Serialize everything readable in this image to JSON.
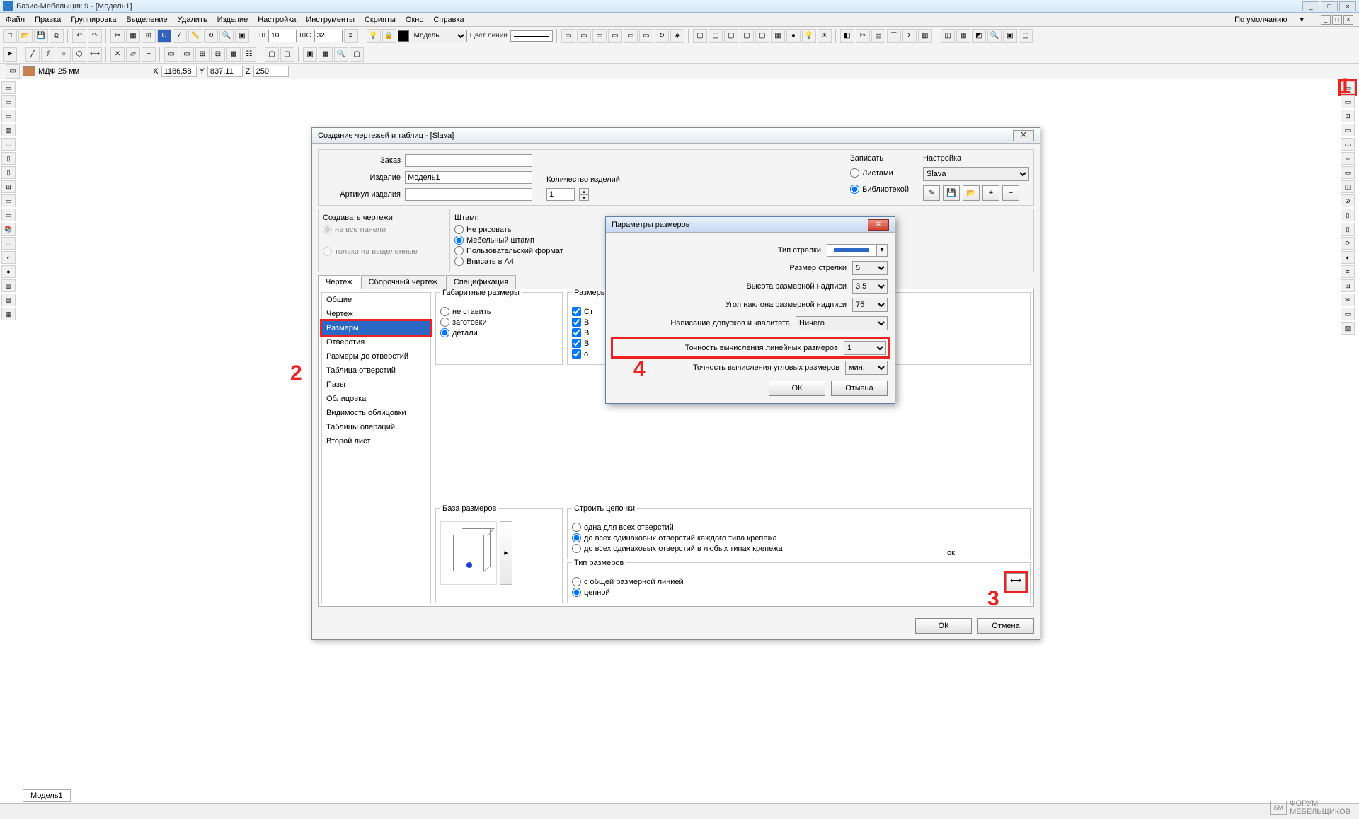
{
  "app": {
    "title": "Базис-Мебельщик 9 - [Модель1]"
  },
  "menu": [
    "Файл",
    "Правка",
    "Группировка",
    "Выделение",
    "Удалить",
    "Изделие",
    "Настройка",
    "Инструменты",
    "Скрипты",
    "Окно",
    "Справка"
  ],
  "menu_right": "По умолчанию",
  "toolbar": {
    "w_label": "Ш",
    "w_value": "10",
    "ws_label": "ШС",
    "ws_value": "32",
    "model_label": "Модель",
    "line_color_label": "Цвет линии"
  },
  "coords": {
    "material": "МДФ 25 мм",
    "x_label": "X",
    "x": "1186,58",
    "y_label": "Y",
    "y": "837,11",
    "z_label": "Z",
    "z": "250"
  },
  "dialog1": {
    "title": "Создание чертежей и таблиц - [Slava]",
    "order_label": "Заказ",
    "order": "",
    "product_label": "Изделие",
    "product": "Модель1",
    "article_label": "Артикул изделия",
    "article": "",
    "qty_label": "Количество изделий",
    "qty": "1",
    "create_legend": "Создавать чертежи",
    "create_all": "на все панели",
    "create_sel": "только на выделенные",
    "stamp_legend": "Штамп",
    "stamp_none": "Не рисовать",
    "stamp_meb": "Мебельный штамп",
    "stamp_user": "Пользовательский формат",
    "stamp_a4": "Вписать в А4",
    "save_legend": "Записать",
    "save_sheets": "Листами",
    "save_lib": "Библиотекой",
    "settings_legend": "Настройка",
    "settings_value": "Slava",
    "tabs": [
      "Чертеж",
      "Сборочный чертеж",
      "Спецификация"
    ],
    "list": [
      "Общие",
      "Чертеж",
      "Размеры",
      "Отверстия",
      "Размеры до отверстий",
      "Таблица отверстий",
      "Пазы",
      "Облицовка",
      "Видимость облицовки",
      "Таблицы операций",
      "Второй лист"
    ],
    "overall_legend": "Габаритные размеры",
    "ov_none": "не ставить",
    "ov_blank": "заготовки",
    "ov_detail": "детали",
    "dims_legend": "Размеры",
    "dims_put": "Ст",
    "dims_v1": "В",
    "dims_v2": "В",
    "dims_v3": "В",
    "dims_o": "о",
    "visible_word": "ок",
    "base_legend": "База размеров",
    "chain_legend": "Строить цепочки",
    "chain_one": "одна для всех отверстий",
    "chain_same": "до всех одинаковых отверстий каждого типа крепежа",
    "chain_any": "до всех одинаковых отверстий в любых типах крепежа",
    "dimtype_legend": "Тип размеров",
    "dimtype_common": "с общей размерной линией",
    "dimtype_chain": "цепной",
    "ok": "ОК",
    "cancel": "Отмена"
  },
  "dialog2": {
    "title": "Параметры размеров",
    "arrow_type": "Тип стрелки",
    "arrow_size": "Размер стрелки",
    "arrow_size_v": "5",
    "text_height": "Высота размерной надписи",
    "text_height_v": "3,5",
    "angle": "Угол наклона размерной надписи",
    "angle_v": "75",
    "tolerance": "Написание допусков и квалитета",
    "tolerance_v": "Ничего",
    "linear_prec": "Точность вычисления линейных размеров",
    "linear_prec_v": "1",
    "angular_prec": "Точность вычисления угловых размеров",
    "angular_prec_v": "мин.",
    "ok": "ОК",
    "cancel": "Отмена"
  },
  "annotations": {
    "a1": "1",
    "a2": "2",
    "a3": "3",
    "a4": "4"
  },
  "bottom_tab": "Модель1",
  "watermark": {
    "l1": "ФОРУМ",
    "l2": "МЕБЕЛЬЩИКОВ",
    "logo": "SM"
  }
}
